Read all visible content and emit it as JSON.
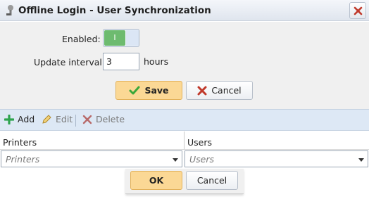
{
  "window": {
    "title": "Offline Login - User Synchronization",
    "title_icon": "user-key-icon",
    "close_icon": "close-icon"
  },
  "form": {
    "enabled_label": "Enabled:",
    "enabled_state_text": "I",
    "enabled_value": true,
    "interval_label": "Update interval:",
    "interval_value": "3",
    "interval_unit": "hours"
  },
  "actions": {
    "save_label": "Save",
    "cancel_label": "Cancel"
  },
  "toolbar": {
    "add_label": "Add",
    "edit_label": "Edit",
    "delete_label": "Delete"
  },
  "grid": {
    "columns": [
      "Printers",
      "Users"
    ],
    "filters": [
      {
        "placeholder": "Printers"
      },
      {
        "placeholder": "Users"
      }
    ]
  },
  "footer": {
    "ok_label": "OK",
    "cancel_label": "Cancel"
  },
  "colors": {
    "toggle_on": "#6dbb6f",
    "primary_button": "#fbd895",
    "toolbar_bg": "#dde8f5",
    "close_x": "#c0392b",
    "add_icon": "#2ea44f",
    "save_check": "#3aa83a",
    "cancel_x": "#c0392b"
  }
}
